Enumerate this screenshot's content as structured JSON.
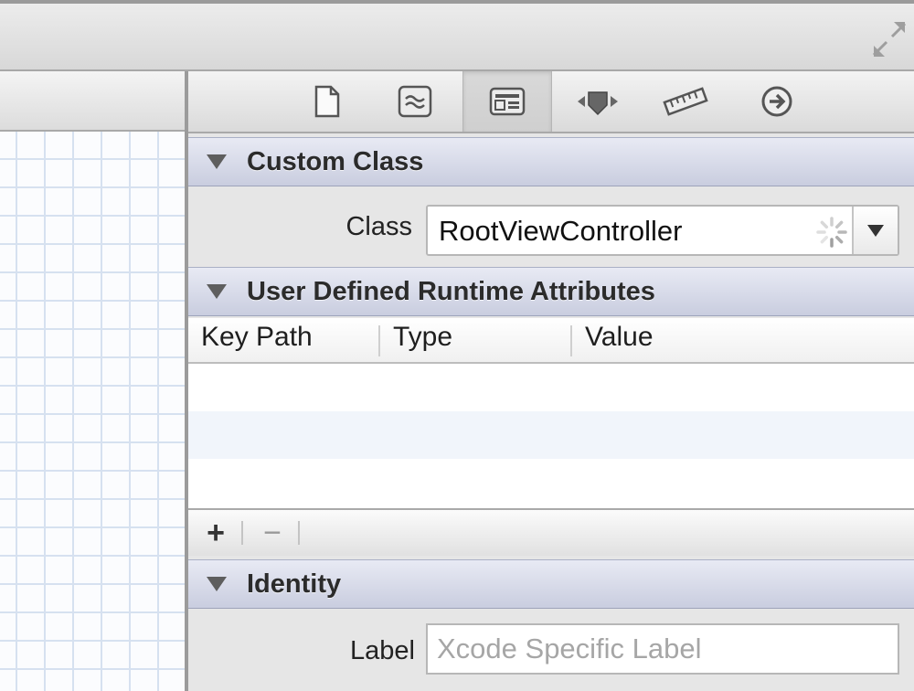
{
  "toolbar": {
    "fullscreen_icon": "fullscreen-arrows-icon"
  },
  "inspector": {
    "tabs": [
      {
        "icon": "file-icon"
      },
      {
        "icon": "quick-help-icon"
      },
      {
        "icon": "identity-inspector-icon",
        "selected": true
      },
      {
        "icon": "attributes-inspector-icon"
      },
      {
        "icon": "size-inspector-icon"
      },
      {
        "icon": "connections-inspector-icon"
      }
    ],
    "custom_class": {
      "title": "Custom Class",
      "class_label": "Class",
      "class_value": "RootViewController"
    },
    "runtime_attributes": {
      "title": "User Defined Runtime Attributes",
      "columns": [
        "Key Path",
        "Type",
        "Value"
      ],
      "add_label": "+",
      "remove_label": "−"
    },
    "identity": {
      "title": "Identity",
      "label_label": "Label",
      "label_placeholder": "Xcode Specific Label",
      "label_value": ""
    }
  },
  "colors": {
    "section_header": "#c9cddf",
    "grid": "#d6e1f0",
    "row_alt": "#f1f5fb"
  }
}
